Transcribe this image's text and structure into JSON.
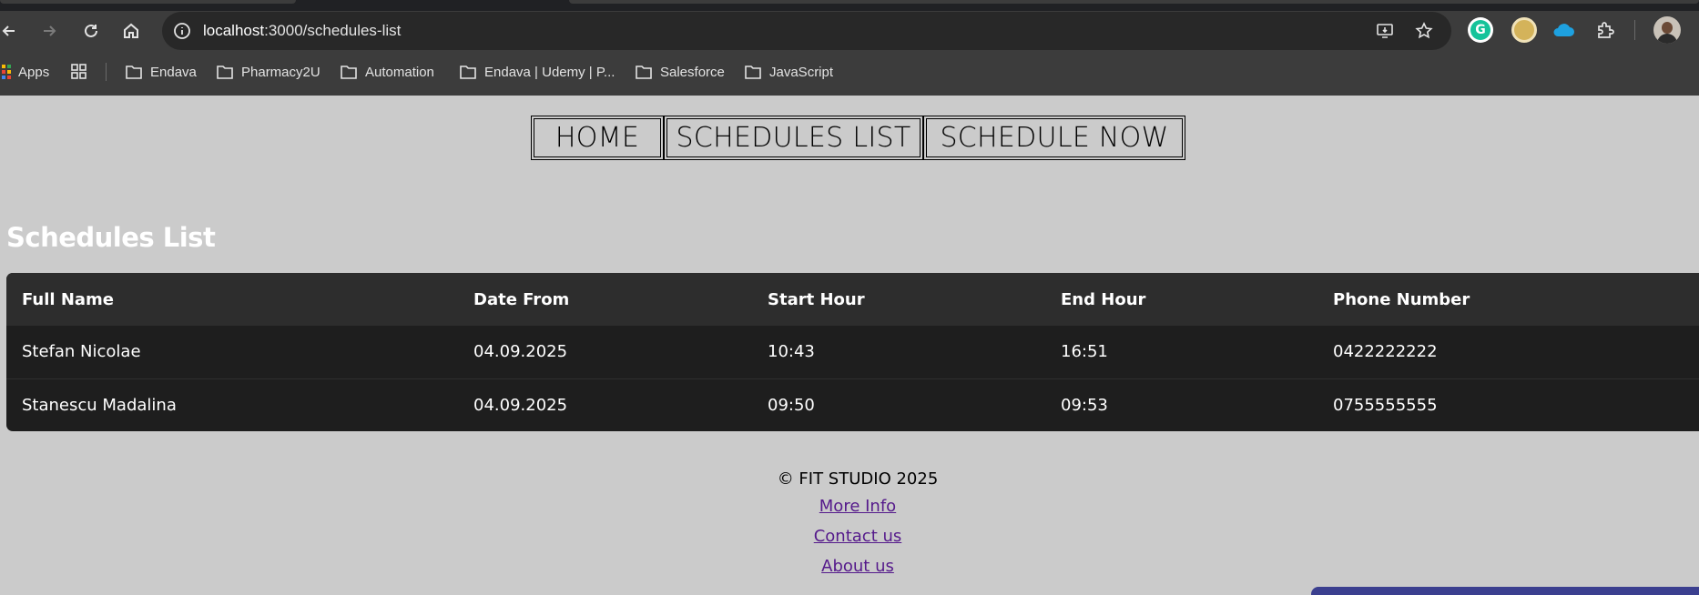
{
  "browser": {
    "url_host": "localhost",
    "url_path": ":3000/schedules-list",
    "nav": [
      "back-icon",
      "forward-icon",
      "reload-icon",
      "home-icon"
    ],
    "extensions": [
      "grammarly-icon",
      "coin-extension-icon",
      "cloud-extension-icon",
      "extensions-puzzle-icon"
    ],
    "grammarly_letter": "G",
    "bookmarks": {
      "apps": "Apps",
      "folders": [
        "Endava",
        "Pharmacy2U",
        "Automation",
        "Endava | Udemy | P...",
        "Salesforce",
        "JavaScript"
      ]
    }
  },
  "nav": {
    "home": "HOME",
    "schedules_list": "SCHEDULES LIST",
    "schedule_now": "SCHEDULE NOW"
  },
  "page": {
    "title": "Schedules List"
  },
  "table": {
    "headers": [
      "Full Name",
      "Date From",
      "Start Hour",
      "End Hour",
      "Phone Number"
    ],
    "rows": [
      [
        "Stefan Nicolae",
        "04.09.2025",
        "10:43",
        "16:51",
        "0422222222"
      ],
      [
        "Stanescu Madalina",
        "04.09.2025",
        "09:50",
        "09:53",
        "0755555555"
      ]
    ]
  },
  "footer": {
    "copyright": "© FIT STUDIO 2025",
    "more_info": "More Info",
    "contact": "Contact us",
    "about": "About us"
  },
  "colors": {
    "page_bg": "#cbcbcb",
    "table_bg": "#1e1e1e",
    "table_header_bg": "#2d2d2d",
    "link": "#551a8b",
    "chrome_bg": "#3c3c3c"
  }
}
